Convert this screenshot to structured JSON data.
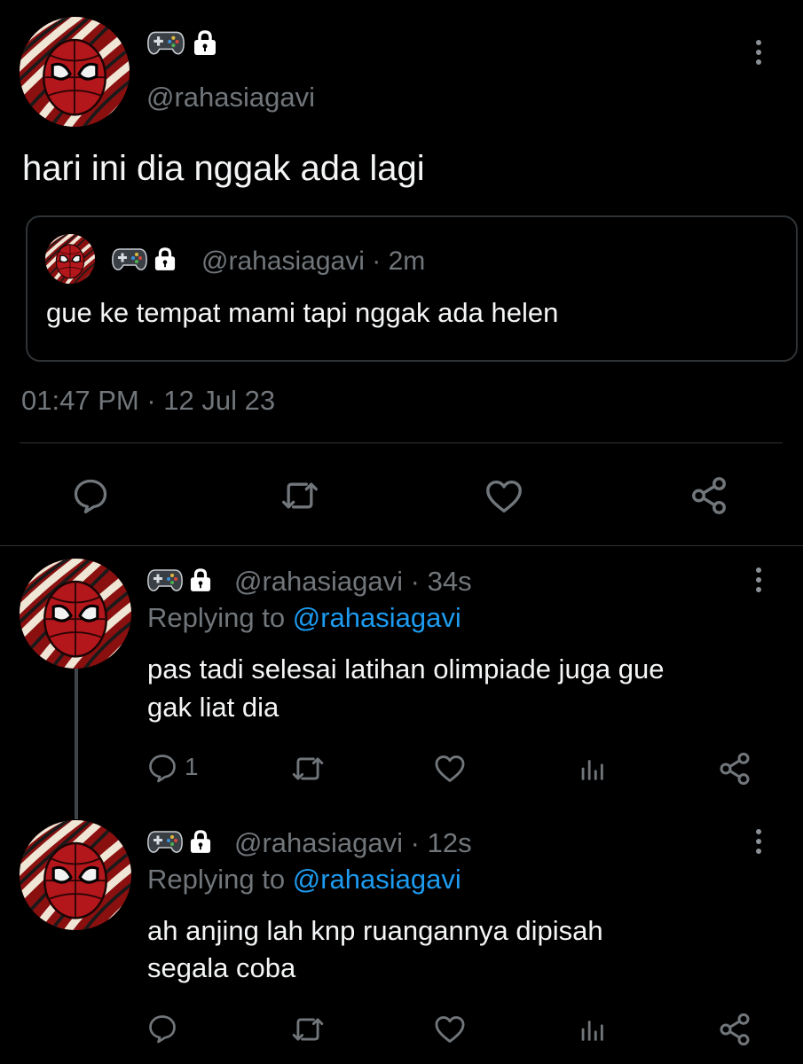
{
  "main_tweet": {
    "handle": "@rahasiagavi",
    "text": "hari ini dia nggak ada lagi",
    "timestamp": "01:47 PM · 12 Jul 23",
    "badge_icons": [
      "gamepad-icon",
      "lock-icon"
    ]
  },
  "quoted_tweet": {
    "handle": "@rahasiagavi",
    "separator": "·",
    "time": "2m",
    "text": "gue ke tempat mami tapi nggak ada helen"
  },
  "replies": [
    {
      "handle": "@rahasiagavi",
      "separator": "·",
      "time": "34s",
      "replying_prefix": "Replying to",
      "replying_to": "@rahasiagavi",
      "text_line1": "pas tadi selesai latihan olimpiade juga gue",
      "text_line2": "gak liat dia",
      "reply_count": "1"
    },
    {
      "handle": "@rahasiagavi",
      "separator": "·",
      "time": "12s",
      "replying_prefix": "Replying to",
      "replying_to": "@rahasiagavi",
      "text_line1": "ah anjing lah knp ruangannya dipisah",
      "text_line2": "segala coba",
      "reply_count": ""
    }
  ],
  "colors": {
    "background": "#000000",
    "text": "#e7e9ea",
    "secondary": "#71767b",
    "link": "#1d9bf0",
    "border": "#2f3336"
  }
}
